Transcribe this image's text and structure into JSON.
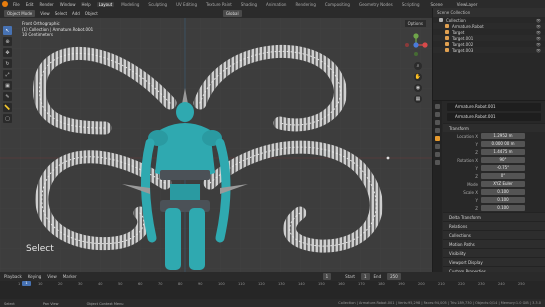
{
  "menubar": {
    "menus": [
      "File",
      "Edit",
      "Render",
      "Window",
      "Help"
    ],
    "workspaces": [
      "Layout",
      "Modeling",
      "Sculpting",
      "UV Editing",
      "Texture Paint",
      "Shading",
      "Animation",
      "Rendering",
      "Compositing",
      "Geometry Nodes",
      "Scripting"
    ],
    "active_workspace": "Layout",
    "scene": "Scene",
    "view_layer": "ViewLayer"
  },
  "viewport": {
    "mode": "Object Mode",
    "menus": [
      "View",
      "Select",
      "Add",
      "Object"
    ],
    "orientation": "Global",
    "info": [
      "Front Orthographic",
      "(1) Collection | Armature.Robot.001",
      "10 Centimeters"
    ],
    "options_label": "Options",
    "operator_label": "Select"
  },
  "outliner": {
    "title": "Scene Collection",
    "rows": [
      {
        "name": "Collection",
        "color": "#b0b0b0"
      },
      {
        "name": "Armature.Robot",
        "color": "#e0a050"
      },
      {
        "name": "Target",
        "color": "#e0a050"
      },
      {
        "name": "Target.001",
        "color": "#e0a050"
      },
      {
        "name": "Target.002",
        "color": "#e0a050"
      },
      {
        "name": "Target.003",
        "color": "#e0a050"
      }
    ]
  },
  "properties": {
    "object_name": "Armature.Robot.001",
    "data_name": "Armature.Robot.001",
    "transform_header": "Transform",
    "location": {
      "label": "Location X",
      "x": "1.2952 m",
      "y": "0.000 00 m",
      "z": "1.4475 m",
      "ylabel": "Y",
      "zlabel": "Z"
    },
    "rotation": {
      "label": "Rotation X",
      "x": "90°",
      "y": "-0.75°",
      "z": "0°",
      "ylabel": "Y",
      "zlabel": "Z"
    },
    "mode": {
      "label": "Mode",
      "value": "XYZ Euler"
    },
    "scale": {
      "label": "Scale X",
      "x": "0.100",
      "y": "0.100",
      "z": "0.100",
      "ylabel": "Y",
      "zlabel": "Z"
    },
    "sections": [
      "Delta Transform",
      "Relations",
      "Collections",
      "Motion Paths",
      "Visibility",
      "Viewport Display",
      "Custom Properties"
    ]
  },
  "timeline": {
    "menus": [
      "Playback",
      "Keying",
      "View",
      "Marker"
    ],
    "current_frame": "1",
    "start_label": "Start",
    "start": "1",
    "end_label": "End",
    "end": "250",
    "ticks": [
      "1",
      "10",
      "20",
      "30",
      "40",
      "50",
      "60",
      "70",
      "80",
      "90",
      "100",
      "110",
      "120",
      "130",
      "140",
      "150",
      "160",
      "170",
      "180",
      "190",
      "200",
      "210",
      "220",
      "230",
      "240",
      "250"
    ]
  },
  "statusbar": {
    "items": [
      "Select",
      "Pan View",
      "Object Context Menu"
    ],
    "right": "Collection | Armature.Robot.001 | Verts:95,298 | Faces:94,005 | Tris:189,730 | Objects:0/14 | Memory:1.0 GiB | 3.3.0"
  },
  "colors": {
    "accent": "#4772b3",
    "robot": "#2fa9b0",
    "viewport_bg": "#3d3d3d"
  }
}
